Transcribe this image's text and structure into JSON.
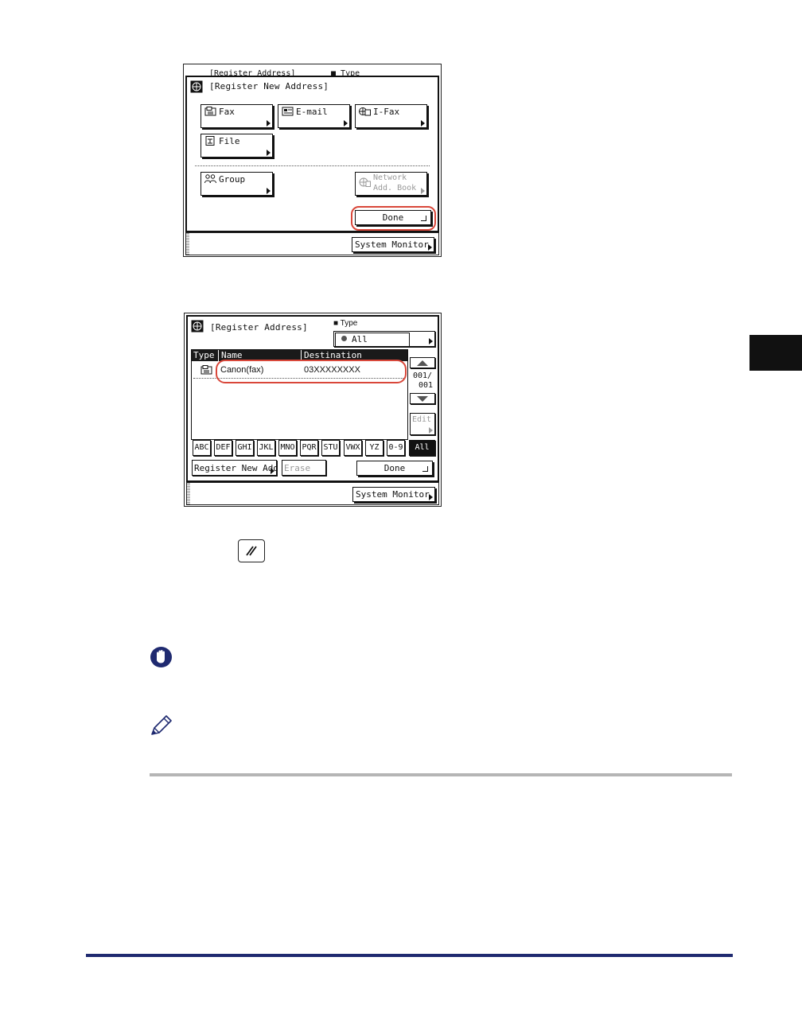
{
  "screen1": {
    "behind_title": "[Register Address]",
    "behind_type": "Type",
    "title": "[Register New Address]",
    "buttons": {
      "fax": "Fax",
      "email": "E-mail",
      "ifax": "I-Fax",
      "file": "File",
      "group": "Group",
      "network_line1": "Network",
      "network_line2": "Add. Book",
      "done": "Done"
    },
    "system_monitor": "System Monitor"
  },
  "screen2": {
    "title": "[Register Address]",
    "type_label": "Type",
    "type_value": "All",
    "columns": {
      "type": "Type",
      "name": "Name",
      "destination": "Destination"
    },
    "rows": [
      {
        "type_icon": "fax-icon",
        "name": "Canon(fax)",
        "destination": "03XXXXXXXX"
      }
    ],
    "page_current": "001/",
    "page_total": "001",
    "edit": "Edit",
    "letters": [
      "ABC",
      "DEF",
      "GHI",
      "JKL",
      "MNO",
      "PQR",
      "STU",
      "VWX",
      "YZ",
      "0-9",
      "All"
    ],
    "register_new": "Register New Add",
    "erase": "Erase",
    "done": "Done",
    "system_monitor": "System Monitor"
  },
  "icons": {
    "reset_key": "reset-key-icon",
    "important": "stop-hand-icon",
    "note": "pencil-icon"
  },
  "colors": {
    "highlight_ring": "#d9473a",
    "important_icon": "#1f2a70",
    "footer_rule": "#1f2a70",
    "section_rule": "#b5b5b5"
  }
}
